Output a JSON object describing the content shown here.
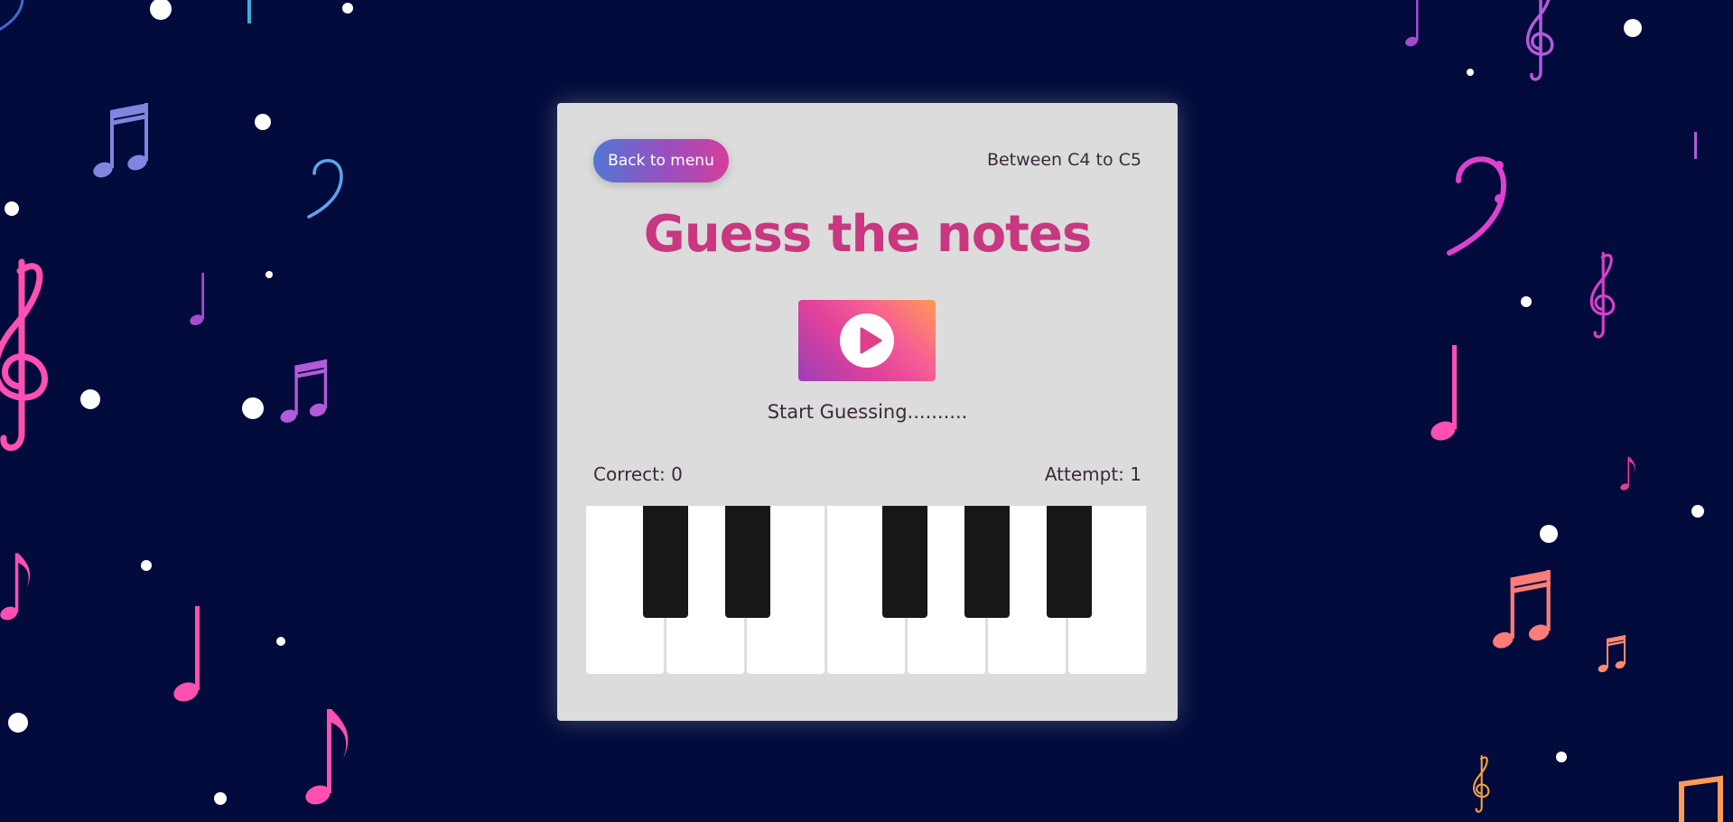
{
  "header": {
    "back_label": "Back to menu",
    "range_label": "Between C4 to C5"
  },
  "main": {
    "title": "Guess the notes",
    "status": "Start Guessing..........",
    "correct_label": "Correct: 0",
    "attempt_label": "Attempt: 1"
  },
  "icons": {
    "play": "play-icon"
  },
  "colors": {
    "background": "#020b3b",
    "card": "#dcdcdc",
    "title": "#c8377f",
    "text": "#3a2a3a",
    "black_key": "#171717"
  }
}
